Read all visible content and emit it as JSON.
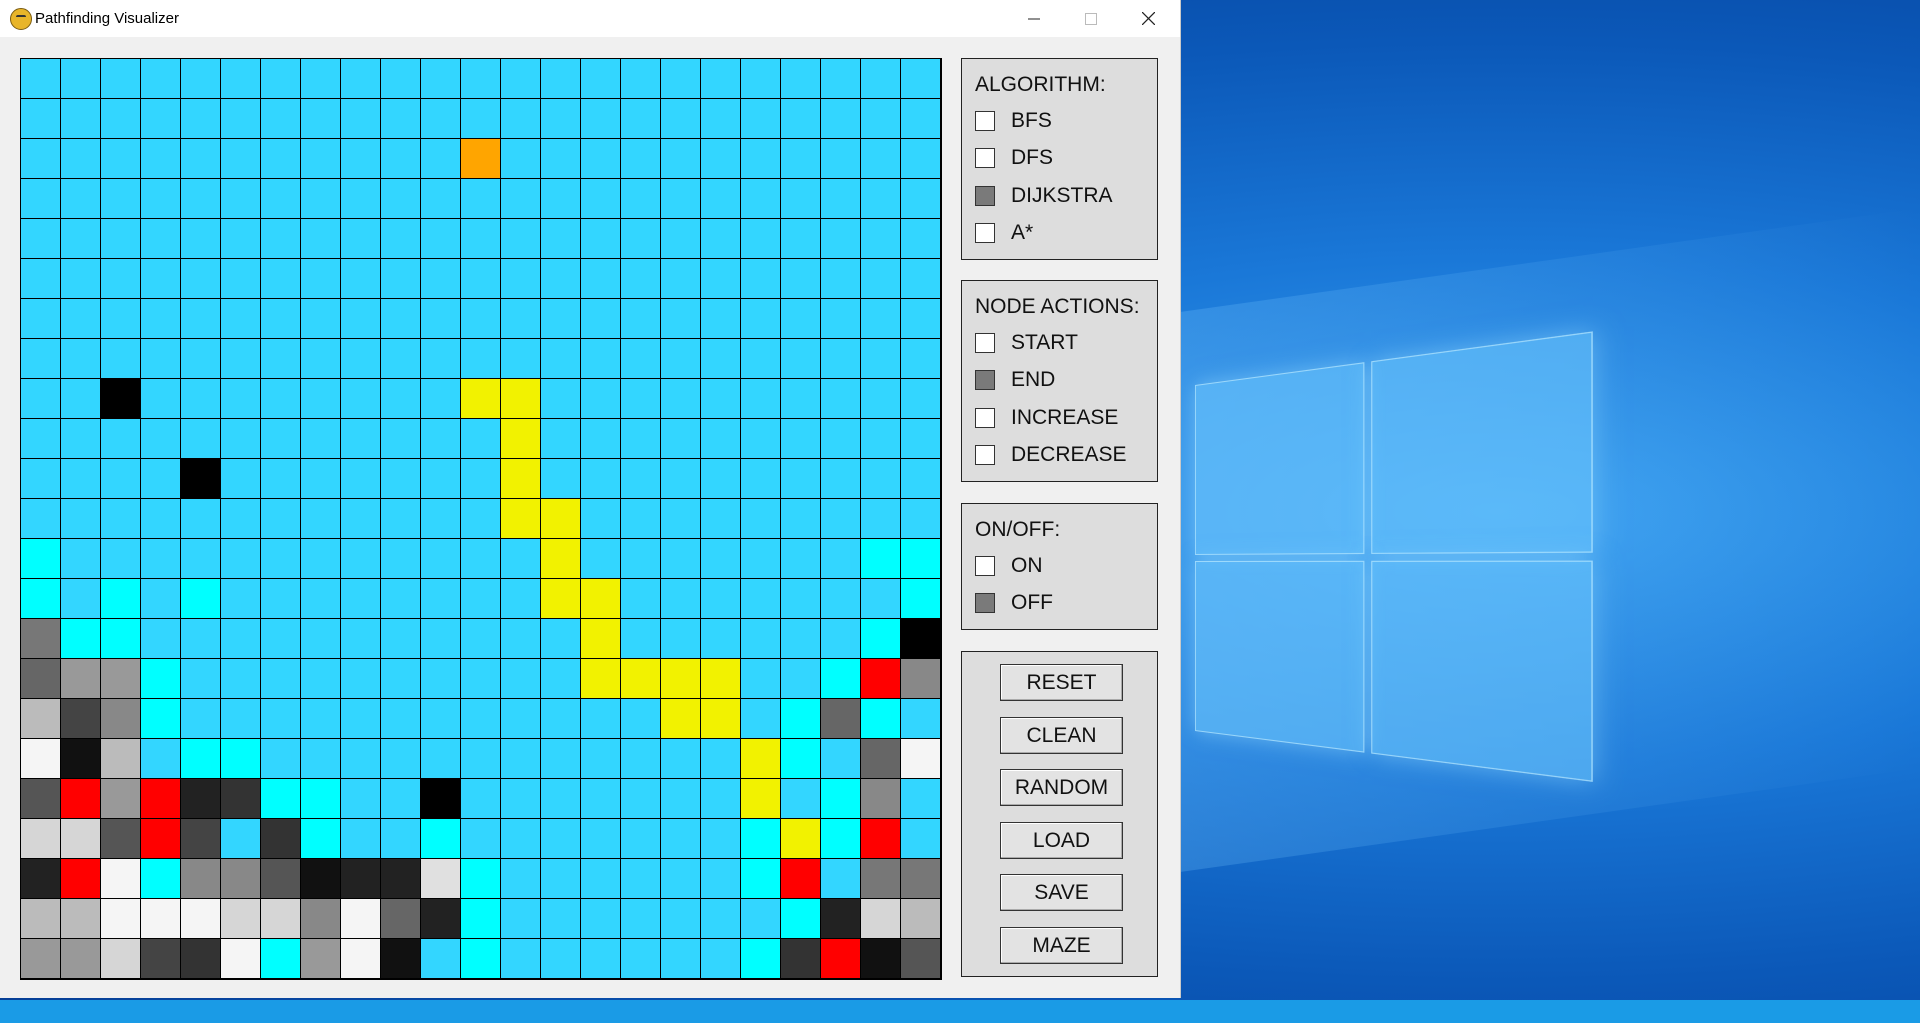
{
  "window": {
    "title": "Pathfinding Visualizer",
    "min_icon": "minimize-icon",
    "max_icon": "maximize-icon",
    "close_icon": "close-icon",
    "app_icon": "python-icon"
  },
  "colors": {
    "C": "#33d6ff",
    "A": "#00ffff",
    "Y": "#f2f200",
    "S": "#ffa500",
    "E": "#ff0000",
    "K": "#000000"
  },
  "grid": {
    "rows": [
      "CCCCCCCCCCCCCCCCCCCCCCC",
      "CCCCCCCCCCCCCCCCCCCCCCC",
      "CCCCCCCCCCCSCCCCCCCCCCC",
      "CCCCCCCCCCCCCCCCCCCCCCC",
      "CCCCCCCCCCCCCCCCCCCCCCC",
      "CCCCCCCCCCCCCCCCCCCCCCC",
      "CCCCCCCCCCCCCCCCCCCCCCC",
      "CCCCCCCCCCCCCCCCCCCCCCC",
      "CCKCCCCCCCCYYCCCCCCCCCC",
      "CCCCCCCCCCCCYCCCCCCCCCC",
      "CCCCKCCCCCCCYCCCCCCCCCC",
      "CCCCCCCCCCCCYYCCCCCCCCC",
      "ACCCCCCCCCCCCYCCCCCCCAA",
      "ACACACCCCCCCCYYCCCCCCCA",
      "7AACCCCCCCCCCCYCCCCCCAK",
      "699ACCCCCCCCCCYYYYCCAE8",
      "B48ACCCCCCCCCCCCYYCA6A",
      "F1BCAACCCCCCCCCCCCYAC6F",
      "5E9E23AACCKCCCCCCCYCA8",
      "DD5E4C3ACCACCCCCCCAYAEC",
      "2EFA885122ZACCCCCCAEC77",
      "BBFFFDD8F62ACCCCCCCA2DB",
      "99D43FA9F1CACCCCCCA3E15"
    ],
    "shades": {
      "0": "#000000",
      "1": "#111111",
      "2": "#222222",
      "3": "#333333",
      "4": "#444444",
      "5": "#555555",
      "6": "#666666",
      "7": "#777777",
      "8": "#888888",
      "9": "#999999",
      "A": "#aaaaaa",
      "B": "#bbbbbb",
      "D": "#d6d6d6",
      "E": "#ececec",
      "F": "#f5f5f5",
      "Z": "#e0e0e0"
    }
  },
  "algorithm_panel": {
    "title": "ALGORITHM:",
    "options": [
      {
        "label": "BFS",
        "checked": false
      },
      {
        "label": "DFS",
        "checked": false
      },
      {
        "label": "DIJKSTRA",
        "checked": true
      },
      {
        "label": "A*",
        "checked": false
      }
    ]
  },
  "node_panel": {
    "title": "NODE ACTIONS:",
    "options": [
      {
        "label": "START",
        "checked": false
      },
      {
        "label": "END",
        "checked": true
      },
      {
        "label": "INCREASE",
        "checked": false
      },
      {
        "label": "DECREASE",
        "checked": false
      }
    ]
  },
  "onoff_panel": {
    "title": "ON/OFF:",
    "options": [
      {
        "label": "ON",
        "checked": false
      },
      {
        "label": "OFF",
        "checked": true
      }
    ]
  },
  "buttons": [
    "RESET",
    "CLEAN",
    "RANDOM",
    "LOAD",
    "SAVE",
    "MAZE"
  ]
}
